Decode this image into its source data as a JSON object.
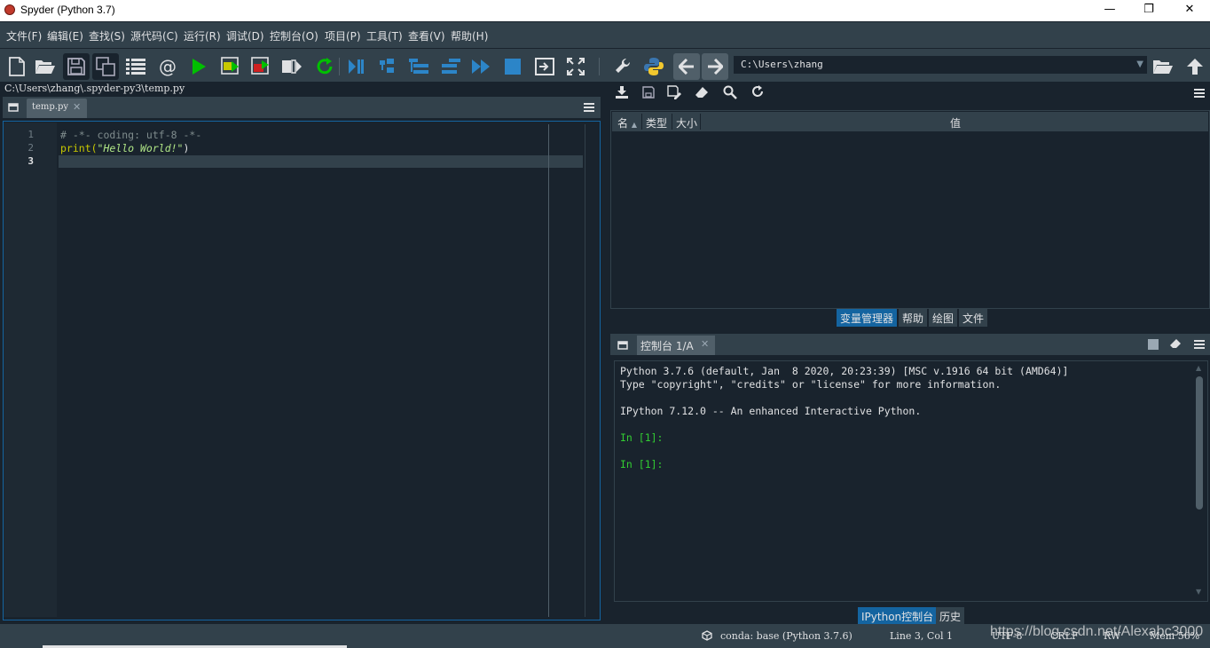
{
  "window": {
    "title": "Spyder (Python 3.7)",
    "minimize": "—",
    "restore": "❐",
    "close": "✕"
  },
  "menu": [
    "文件(F)",
    "编辑(E)",
    "查找(S)",
    "源代码(C)",
    "运行(R)",
    "调试(D)",
    "控制台(O)",
    "项目(P)",
    "工具(T)",
    "查看(V)",
    "帮助(H)"
  ],
  "toolbar": {
    "path": "C:\\Users\\zhang"
  },
  "colors": {
    "background": "#19232d",
    "panel": "#32414b",
    "accent": "#1464a0",
    "run_green": "#00ff00",
    "debug_blue": "#2c85c8"
  },
  "editor": {
    "file_path": "C:\\Users\\zhang\\.spyder-py3\\temp.py",
    "tab_label": "temp.py",
    "line_numbers": [
      "1",
      "2",
      "3"
    ],
    "lines": {
      "l1": "# -*- coding: utf-8 -*-",
      "l2_func": "print(",
      "l2_str": "\"Hello World!\"",
      "l2_end": ")"
    }
  },
  "variable_explorer": {
    "columns": [
      "名",
      "类型",
      "大小",
      "值"
    ],
    "tabs": [
      "变量管理器",
      "帮助",
      "绘图",
      "文件"
    ]
  },
  "console": {
    "tab_label": "控制台 1/A",
    "lines": [
      "Python 3.7.6 (default, Jan  8 2020, 20:23:39) [MSC v.1916 64 bit (AMD64)]",
      "Type \"copyright\", \"credits\" or \"license\" for more information.",
      "IPython 7.12.0 -- An enhanced Interactive Python.",
      "In [1]:",
      "In [1]:"
    ],
    "tabs": [
      "IPython控制台",
      "历史"
    ]
  },
  "status": {
    "env": "conda: base (Python 3.7.6)",
    "position": "Line 3, Col 1",
    "encoding": "UTF-8",
    "eol": "CRLF",
    "perm": "RW",
    "mem": "Mem 56%"
  },
  "watermark": "https://blog.csdn.net/Alexabc3000"
}
